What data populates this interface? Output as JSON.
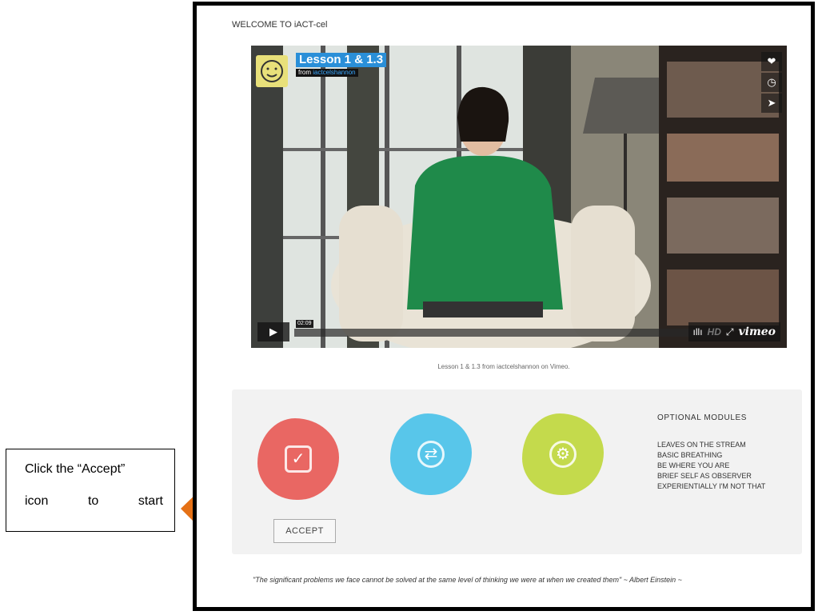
{
  "callout": {
    "line1": "Click the “Accept”",
    "line2": [
      "icon",
      "to",
      "start"
    ]
  },
  "page": {
    "welcome": "WELCOME TO iACT-cel"
  },
  "video": {
    "title": "Lesson 1 & 1.3",
    "from_prefix": "from",
    "from_user": "iactcelshannon",
    "time": "02:09",
    "hd_label": "HD",
    "brand": "vimeo",
    "side_icons": [
      "heart-icon",
      "clock-icon",
      "send-icon"
    ]
  },
  "caption": "Lesson 1 & 1.3 from iactcelshannon on Vimeo.",
  "actions": {
    "accept_label": "ACCEPT"
  },
  "optional_modules": {
    "heading": "OPTIONAL MODULES",
    "items": [
      "LEAVES ON THE STREAM",
      "BASIC BREATHING",
      "BE WHERE YOU ARE",
      "BRIEF SELF AS OBSERVER",
      "EXPERIENTIALLY I'M NOT THAT"
    ]
  },
  "quote": "\"The significant problems we face cannot be solved at the same level of thinking we were at when we created them\" ~ Albert Einstein ~",
  "colors": {
    "accept": "#e96763",
    "refresh": "#58c6ea",
    "settings": "#c4da4c",
    "arrow": "#e57116"
  }
}
